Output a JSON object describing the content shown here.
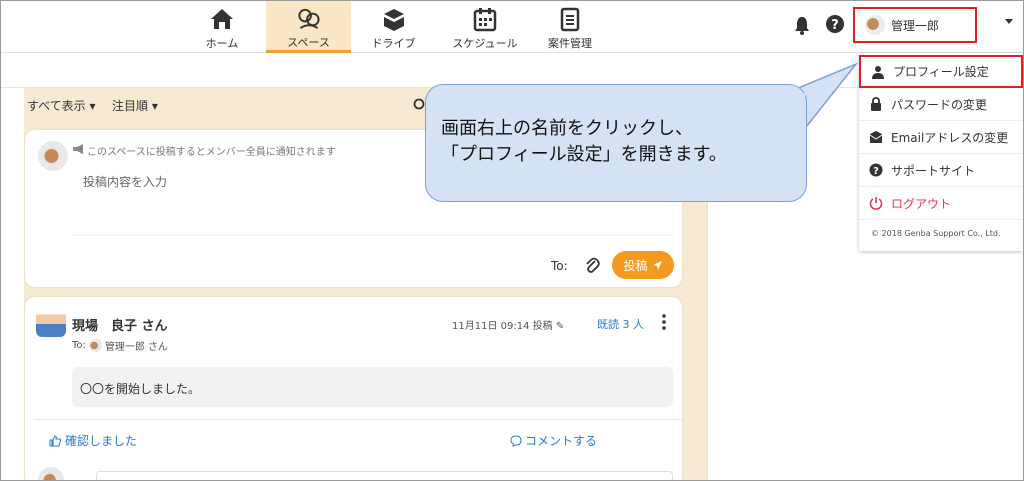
{
  "nav": [
    {
      "label": "ホーム",
      "icon": "home-icon"
    },
    {
      "label": "スペース",
      "icon": "space-icon",
      "active": true
    },
    {
      "label": "ドライブ",
      "icon": "drive-icon"
    },
    {
      "label": "スケジュール",
      "icon": "calendar-icon"
    },
    {
      "label": "案件管理",
      "icon": "clipboard-icon"
    }
  ],
  "user": {
    "name": "管理一郎"
  },
  "filters": {
    "show_all": "すべて表示",
    "sort": "注目順"
  },
  "composer": {
    "notice": "このスペースに投稿するとメンバー全員に通知されます",
    "placeholder": "投稿内容を入力",
    "to_label": "To:",
    "post_label": "投稿"
  },
  "post": {
    "author": "現場　良子 さん",
    "datetime": "11月11日 09:14",
    "posted": "投稿",
    "read_count": "既読 3 人",
    "to_label": "To:",
    "to_name": "管理一郎",
    "to_suffix": "さん",
    "message": "〇〇を開始しました。",
    "confirm_label": "確認しました",
    "comment_label": "コメントする"
  },
  "dropdown": {
    "items": [
      {
        "label": "プロフィール設定",
        "icon": "person-icon"
      },
      {
        "label": "パスワードの変更",
        "icon": "lock-icon"
      },
      {
        "label": "Emailアドレスの変更",
        "icon": "envelope-icon"
      },
      {
        "label": "サポートサイト",
        "icon": "question-icon"
      },
      {
        "label": "ログアウト",
        "icon": "power-icon"
      }
    ],
    "copyright": "© 2018 Genba Support Co., Ltd."
  },
  "callout": {
    "line1": "画面右上の名前をクリックし、",
    "line2": "「プロフィール設定」を開きます。"
  },
  "colors": {
    "accent": "#f39a1f",
    "highlight": "#e02020",
    "link": "#2a7ad6",
    "logout": "#e8344f",
    "callout_bg": "#d5e1f4"
  }
}
